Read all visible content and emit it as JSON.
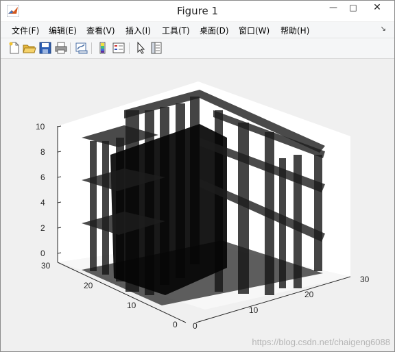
{
  "window": {
    "title": "Figure 1",
    "minimize_symbol": "—",
    "maximize_symbol": "□",
    "close_symbol": "✕"
  },
  "menu": {
    "items": [
      {
        "label": "文件(F)"
      },
      {
        "label": "编辑(E)"
      },
      {
        "label": "查看(V)"
      },
      {
        "label": "插入(I)"
      },
      {
        "label": "工具(T)"
      },
      {
        "label": "桌面(D)"
      },
      {
        "label": "窗口(W)"
      },
      {
        "label": "帮助(H)"
      }
    ],
    "pin_symbol": "↘"
  },
  "toolbar": {
    "icons": [
      "new-figure-icon",
      "open-file-icon",
      "save-icon",
      "print-icon",
      "link-plot-icon",
      "insert-colorbar-icon",
      "insert-legend-icon",
      "edit-plot-arrow-icon",
      "property-inspector-icon"
    ]
  },
  "axes": {
    "z_ticks": [
      "0",
      "2",
      "4",
      "6",
      "8",
      "10"
    ],
    "y_ticks": [
      "0",
      "10",
      "20",
      "30"
    ],
    "x_ticks": [
      "10",
      "20",
      "30"
    ],
    "x_zero": "0"
  },
  "chart_data": {
    "type": "3d-structure",
    "title": "",
    "xlim": [
      0,
      30
    ],
    "ylim": [
      0,
      30
    ],
    "zlim": [
      0,
      10
    ],
    "grid": false,
    "colors": {
      "beam": "#1a1a1a",
      "face": "#ffffff",
      "background": "#f0f0f0"
    }
  },
  "watermark": "https://blog.csdn.net/chaigeng6088"
}
